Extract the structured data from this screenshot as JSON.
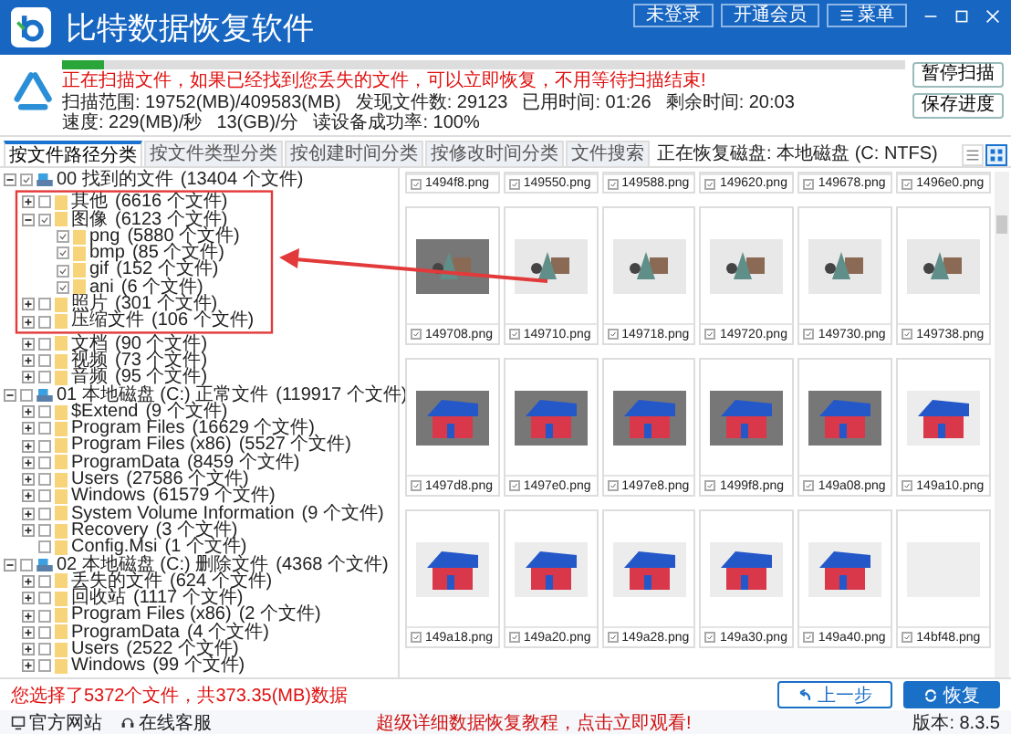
{
  "window": {
    "title": "比特数据恢复软件",
    "buttons": [
      {
        "label": "未登录",
        "kind": "plain"
      },
      {
        "label": "开通会员",
        "kind": "plain"
      },
      {
        "label": "菜单",
        "kind": "menu"
      }
    ]
  },
  "scan": {
    "level": 0.05,
    "message": "正在扫描文件，如果已经找到您丢失的文件，可以立即恢复，不用等待扫描结束!",
    "stats": [
      "扫描范围: 19752(MB)/409583(MB)",
      "发现文件数: 29123",
      "已用时间: 01:26",
      "剩余时间: 20:03",
      "速度: 229(MB)/秒",
      "13(GB)/分",
      "读设备成功率: 100%"
    ],
    "buttons": [
      "暂停扫描",
      "保存进度"
    ]
  },
  "tabs": [
    {
      "label": "按文件路径分类",
      "selected": true
    },
    {
      "label": "按文件类型分类",
      "selected": false
    },
    {
      "label": "按创建时间分类",
      "selected": false
    },
    {
      "label": "按修改时间分类",
      "selected": false
    },
    {
      "label": "文件搜索",
      "selected": false
    }
  ],
  "disk_label": "正在恢复磁盘: 本地磁盘 (C: NTFS)",
  "view_modes": [
    {
      "kind": "list",
      "selected": false
    },
    {
      "kind": "grid",
      "selected": true
    }
  ],
  "tree": [
    {
      "label": "00 找到的文件",
      "count": "(13404 个文件)",
      "checked": true,
      "expanded": true,
      "children": [
        {
          "label": "其他",
          "count": "(6616 个文件)",
          "checked": false,
          "expanded": false
        },
        {
          "label": "图像",
          "count": "(6123 个文件)",
          "checked": true,
          "expanded": true,
          "children": [
            {
              "label": "png",
              "count": "(5880 个文件)",
              "checked": true
            },
            {
              "label": "bmp",
              "count": "(85 个文件)",
              "checked": true
            },
            {
              "label": "gif",
              "count": "(152 个文件)",
              "checked": true
            },
            {
              "label": "ani",
              "count": "(6 个文件)",
              "checked": true
            }
          ]
        },
        {
          "label": "照片",
          "count": "(301 个文件)",
          "checked": false,
          "expanded": false
        },
        {
          "label": "压缩文件",
          "count": "(106 个文件)",
          "checked": false,
          "expanded": false
        },
        {
          "label": "文档",
          "count": "(90 个文件)",
          "checked": false,
          "expanded": false
        },
        {
          "label": "视频",
          "count": "(73 个文件)",
          "checked": false,
          "expanded": false
        },
        {
          "label": "音频",
          "count": "(95 个文件)",
          "checked": false,
          "expanded": false
        }
      ]
    },
    {
      "label": "01 本地磁盘 (C:) 正常文件",
      "count": "(119917 个文件)",
      "checked": false,
      "expanded": true,
      "children": [
        {
          "label": "$Extend",
          "count": "(9 个文件)",
          "checked": false,
          "expanded": false
        },
        {
          "label": "Program Files",
          "count": "(16629 个文件)",
          "checked": false,
          "expanded": false
        },
        {
          "label": "Program Files (x86)",
          "count": "(5527 个文件)",
          "checked": false,
          "expanded": false
        },
        {
          "label": "ProgramData",
          "count": "(8459 个文件)",
          "checked": false,
          "expanded": false
        },
        {
          "label": "Users",
          "count": "(27586 个文件)",
          "checked": false,
          "expanded": false
        },
        {
          "label": "Windows",
          "count": "(61579 个文件)",
          "checked": false,
          "expanded": false
        },
        {
          "label": "System Volume Information",
          "count": "(9 个文件)",
          "checked": false,
          "expanded": false
        },
        {
          "label": "Recovery",
          "count": "(3 个文件)",
          "checked": false,
          "expanded": false
        },
        {
          "label": "Config.Msi",
          "count": "(1 个文件)",
          "checked": false
        }
      ]
    },
    {
      "label": "02 本地磁盘 (C:) 删除文件",
      "count": "(4368 个文件)",
      "checked": false,
      "expanded": true,
      "children": [
        {
          "label": "丢失的文件",
          "count": "(624 个文件)",
          "checked": false,
          "expanded": false
        },
        {
          "label": "回收站",
          "count": "(1117 个文件)",
          "checked": false,
          "expanded": false
        },
        {
          "label": "Program Files (x86)",
          "count": "(2 个文件)",
          "checked": false,
          "expanded": false
        },
        {
          "label": "ProgramData",
          "count": "(4 个文件)",
          "checked": false,
          "expanded": false
        },
        {
          "label": "Users",
          "count": "(2522 个文件)",
          "checked": false,
          "expanded": false
        },
        {
          "label": "Windows",
          "count": "(99 个文件)",
          "checked": false,
          "expanded": false
        }
      ]
    }
  ],
  "files": [
    {
      "name": "1494f8.png",
      "checked": true,
      "kind": "cut"
    },
    {
      "name": "149550.png",
      "checked": true,
      "kind": "cut"
    },
    {
      "name": "149588.png",
      "checked": true,
      "kind": "cut"
    },
    {
      "name": "149620.png",
      "checked": true,
      "kind": "cut"
    },
    {
      "name": "149678.png",
      "checked": true,
      "kind": "cut"
    },
    {
      "name": "1496e0.png",
      "checked": true,
      "kind": "cut"
    },
    {
      "name": "149708.png",
      "checked": true,
      "kind": "shapes",
      "dark": true
    },
    {
      "name": "149710.png",
      "checked": true,
      "kind": "shapes",
      "dark": false
    },
    {
      "name": "149718.png",
      "checked": true,
      "kind": "shapes",
      "dark": false
    },
    {
      "name": "149720.png",
      "checked": true,
      "kind": "shapes",
      "dark": false
    },
    {
      "name": "149730.png",
      "checked": true,
      "kind": "shapes",
      "dark": false
    },
    {
      "name": "149738.png",
      "checked": true,
      "kind": "shapes",
      "dark": false
    },
    {
      "name": "1497d8.png",
      "checked": true,
      "kind": "house",
      "dark": true
    },
    {
      "name": "1497e0.png",
      "checked": true,
      "kind": "house",
      "dark": true
    },
    {
      "name": "1497e8.png",
      "checked": true,
      "kind": "house",
      "dark": true
    },
    {
      "name": "1499f8.png",
      "checked": true,
      "kind": "house",
      "dark": true
    },
    {
      "name": "149a08.png",
      "checked": true,
      "kind": "house",
      "dark": true
    },
    {
      "name": "149a10.png",
      "checked": true,
      "kind": "house",
      "dark": false
    },
    {
      "name": "149a18.png",
      "checked": true,
      "kind": "house",
      "dark": false
    },
    {
      "name": "149a20.png",
      "checked": true,
      "kind": "house",
      "dark": false
    },
    {
      "name": "149a28.png",
      "checked": true,
      "kind": "house",
      "dark": false
    },
    {
      "name": "149a30.png",
      "checked": true,
      "kind": "house",
      "dark": false
    },
    {
      "name": "149a40.png",
      "checked": true,
      "kind": "house",
      "dark": false
    },
    {
      "name": "14bf48.png",
      "checked": true,
      "kind": "plain",
      "dark": false
    }
  ],
  "selection_summary": "您选择了5372个文件，共373.35(MB)数据",
  "actions": [
    {
      "label": "上一步",
      "kind": "back"
    },
    {
      "label": "恢复",
      "kind": "primary"
    }
  ],
  "footer": {
    "links": [
      {
        "label": "官方网站",
        "kind": "site"
      },
      {
        "label": "在线客服",
        "kind": "support"
      }
    ],
    "promo": "超级详细数据恢复教程，点击立即观看!",
    "version": "版本: 8.3.5"
  }
}
